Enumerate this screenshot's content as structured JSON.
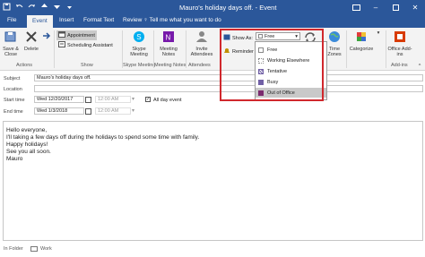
{
  "window": {
    "title": "Mauro's holiday days off. - Event"
  },
  "tabs": [
    {
      "label": "File"
    },
    {
      "label": "Event"
    },
    {
      "label": "Insert"
    },
    {
      "label": "Format Text"
    },
    {
      "label": "Review"
    }
  ],
  "tell_me": "Tell me what you want to do",
  "ribbon": {
    "save_close": "Save & Close",
    "delete": "Delete",
    "forward": "",
    "actions_group": "Actions",
    "appointment": "Appointment",
    "scheduling": "Scheduling Assistant",
    "show_group": "Show",
    "skype": "Skype Meeting",
    "skype_group": "Skype Meeting",
    "meeting_notes": "Meeting Notes",
    "meeting_notes_group": "Meeting Notes",
    "invite": "Invite Attendees",
    "attendees_group": "Attendees",
    "show_as_label": "Show As:",
    "show_as_value": "Free",
    "reminder": "Reminder",
    "time_zones": "Time Zones",
    "categorize": "Categorize",
    "office_addins": "Office Add-ins",
    "addins_group": "Add-ins"
  },
  "dropdown": {
    "items": [
      {
        "label": "Free",
        "color": "#ffffff"
      },
      {
        "label": "Working Elsewhere",
        "color": "#ffffff"
      },
      {
        "label": "Tentative",
        "color": "#ffffff"
      },
      {
        "label": "Busy",
        "color": "#7160a6"
      },
      {
        "label": "Out of Office",
        "color": "#7b2b6e"
      }
    ],
    "selected": "Out of Office"
  },
  "form": {
    "subject_label": "Subject",
    "subject_value": "Mauro's holiday days off.",
    "location_label": "Location",
    "location_value": "",
    "start_label": "Start time",
    "start_date": "Wed 12/20/2017",
    "start_time": "12:00 AM",
    "all_day_label": "All day event",
    "end_label": "End time",
    "end_date": "Wed 1/3/2018",
    "end_time": "12:00 AM"
  },
  "body_lines": [
    "Hello everyone,",
    "I'll taking a few days off during the holidays to spend some time with family.",
    "Happy holidays!",
    "See you all soon.",
    "Mauro"
  ],
  "footer": {
    "in_folder": "In Folder",
    "folder": "Work"
  },
  "colors": {
    "accent": "#2b579a",
    "highlight": "#d0282d"
  }
}
